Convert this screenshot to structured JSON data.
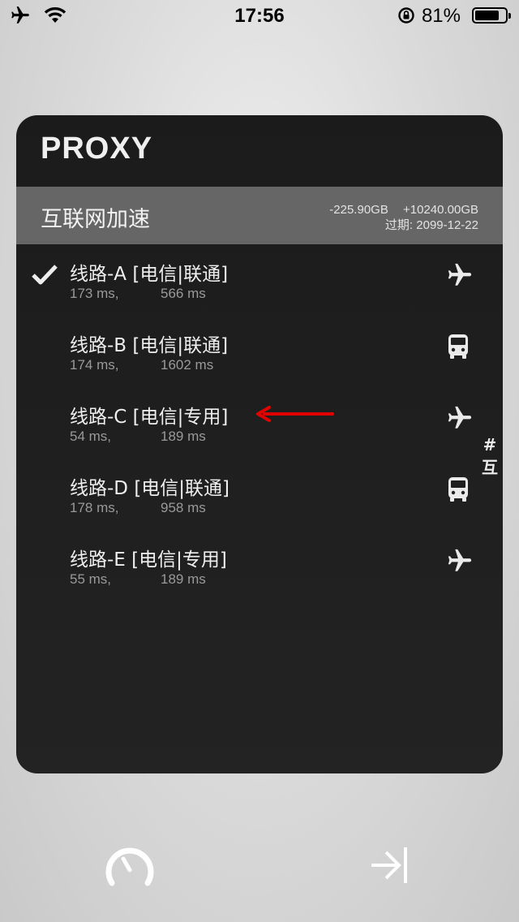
{
  "status_bar": {
    "time": "17:56",
    "battery_percent_text": "81%",
    "battery_level": 0.81
  },
  "panel": {
    "title": "PROXY",
    "service": {
      "name": "互联网加速",
      "usage_down": "-225.90GB",
      "usage_up": "+10240.00GB",
      "expiry": "过期: 2099-12-22"
    },
    "routes": [
      {
        "name": "线路-A [电信|联通]",
        "latency1": "173 ms,",
        "latency2": "566 ms",
        "icon": "airplane-icon",
        "selected": true
      },
      {
        "name": "线路-B [电信|联通]",
        "latency1": "174 ms,",
        "latency2": "1602 ms",
        "icon": "bus-icon",
        "selected": false
      },
      {
        "name": "线路-C [电信|专用]",
        "latency1": "54 ms,",
        "latency2": "189 ms",
        "icon": "airplane-icon",
        "selected": false
      },
      {
        "name": "线路-D [电信|联通]",
        "latency1": "178 ms,",
        "latency2": "958 ms",
        "icon": "bus-icon",
        "selected": false
      },
      {
        "name": "线路-E [电信|专用]",
        "latency1": "55 ms,",
        "latency2": "189 ms",
        "icon": "airplane-icon",
        "selected": false
      }
    ],
    "index": [
      "#",
      "互"
    ]
  },
  "colors": {
    "panel_bg": "#1e1e1e",
    "service_bar": "#666666",
    "annotation_arrow": "#e00000"
  }
}
